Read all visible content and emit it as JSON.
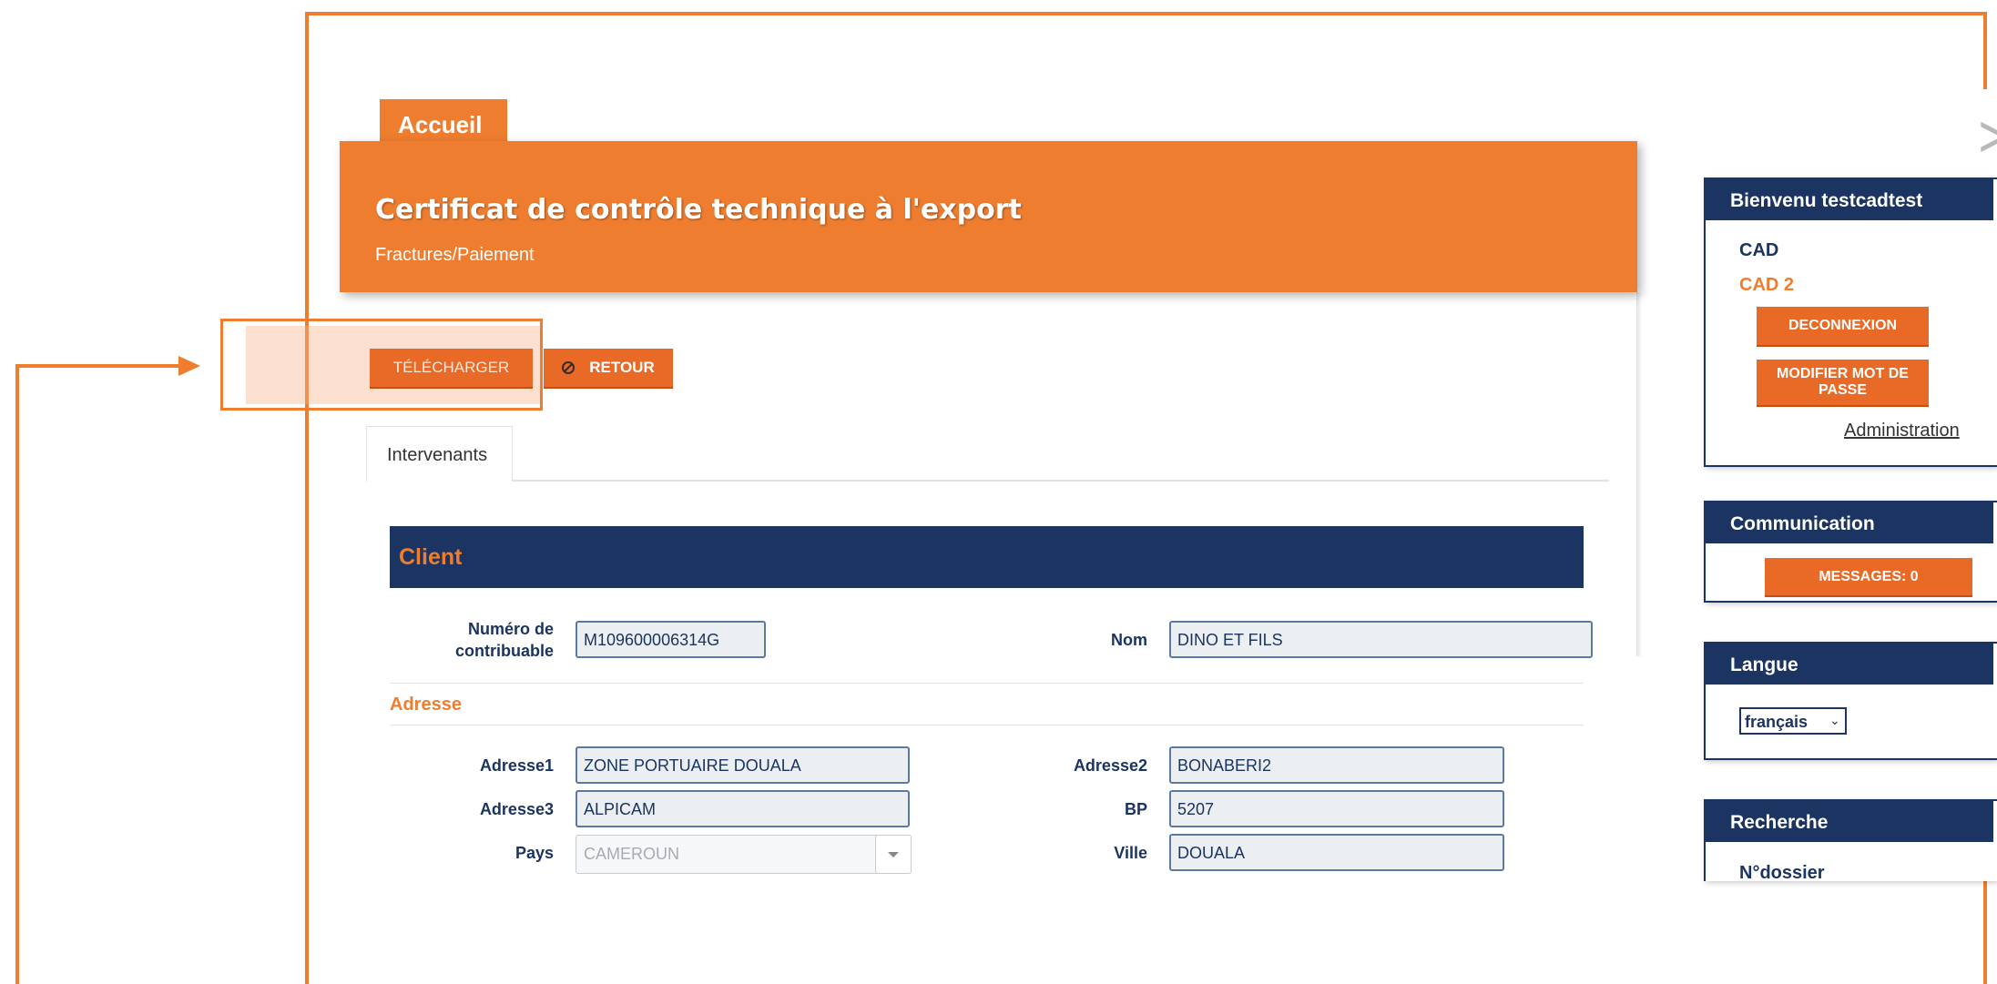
{
  "nav": {
    "home_tab": "Accueil"
  },
  "banner": {
    "title": "Certificat de contrôle technique à l'export",
    "subtitle": "Fractures/Paiement"
  },
  "actions": {
    "download": "TÉLÉCHARGER",
    "back": "RETOUR"
  },
  "tabs": [
    {
      "label": "Intervenants"
    }
  ],
  "client": {
    "section_title": "Client",
    "contrib_label": "Numéro de contribuable",
    "contrib_value": "M109600006314G",
    "name_label": "Nom",
    "name_value": "DINO ET FILS",
    "address_title": "Adresse",
    "adresse1_label": "Adresse1",
    "adresse1_value": "ZONE PORTUAIRE DOUALA",
    "adresse2_label": "Adresse2",
    "adresse2_value": "BONABERI2",
    "adresse3_label": "Adresse3",
    "adresse3_value": "ALPICAM",
    "bp_label": "BP",
    "bp_value": "5207",
    "country_label": "Pays",
    "country_value": "CAMEROUN",
    "city_label": "Ville",
    "city_value": "DOUALA"
  },
  "sidebar": {
    "welcome_title": "Bienvenu testcadtest",
    "cad": "CAD",
    "cad2": "CAD 2",
    "logout": "DECONNEXION",
    "change_password": "MODIFIER MOT DE PASSE",
    "admin": "Administration",
    "comm_title": "Communication",
    "messages": "MESSAGES: 0",
    "lang_title": "Langue",
    "lang_value": "français",
    "search_title": "Recherche",
    "dossier_label": "N°dossier"
  },
  "colors": {
    "accent": "#ef7d2f",
    "navy": "#1b3461"
  },
  "icons": {
    "expand": "chevron-right-icon",
    "back": "ban-icon",
    "select": "chevron-down-icon"
  }
}
